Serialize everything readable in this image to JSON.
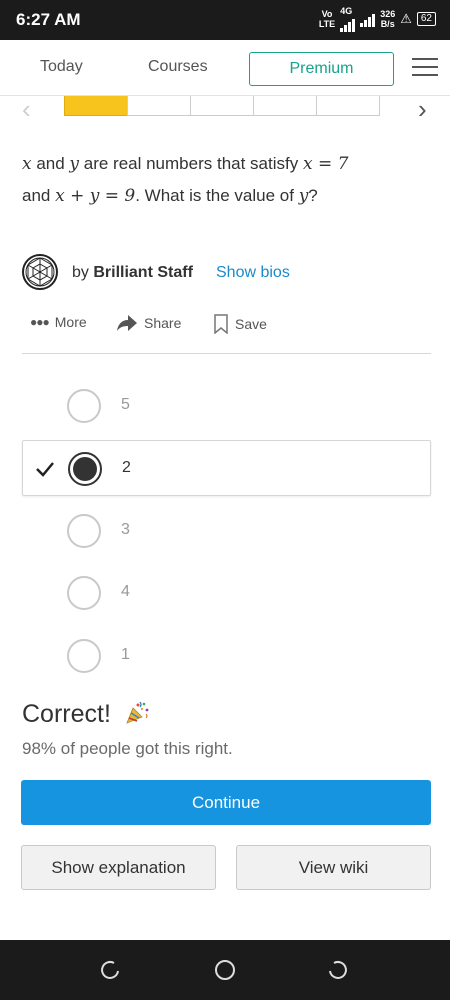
{
  "status_bar": {
    "time": "6:27 AM",
    "volte_top": "Vo",
    "volte_bottom": "LTE",
    "network": "4G",
    "speed_value": "326",
    "speed_unit": "B/s",
    "battery": "62"
  },
  "nav": {
    "today": "Today",
    "courses": "Courses",
    "premium": "Premium"
  },
  "progress": {
    "total_steps": 5,
    "completed_steps": 1
  },
  "question": {
    "text_before_1": "",
    "var_x": "x",
    "text_and": " and ",
    "var_y": "y",
    "text_mid": " are real numbers that satisfy ",
    "eq1": "x = 7",
    "text_and2": "and ",
    "eq2": "x + y = 9",
    "text_end": ". What is the value of ",
    "var_y2": "y",
    "q_mark": "?"
  },
  "author": {
    "by": "by ",
    "name": "Brilliant Staff",
    "show_bios": "Show bios"
  },
  "actions": {
    "more": "More",
    "share": "Share",
    "save": "Save"
  },
  "choices": [
    {
      "label": "5",
      "selected": false
    },
    {
      "label": "2",
      "selected": true
    },
    {
      "label": "3",
      "selected": false
    },
    {
      "label": "4",
      "selected": false
    },
    {
      "label": "1",
      "selected": false
    }
  ],
  "result": {
    "title": "Correct!",
    "percent": "98% of people got this right."
  },
  "buttons": {
    "continue": "Continue",
    "show_explanation": "Show explanation",
    "view_wiki": "View wiki"
  },
  "colors": {
    "accent_blue": "#1694e0",
    "premium_green": "#18a38a",
    "progress_yellow": "#f7c31d",
    "link_blue": "#1a8bc9"
  }
}
